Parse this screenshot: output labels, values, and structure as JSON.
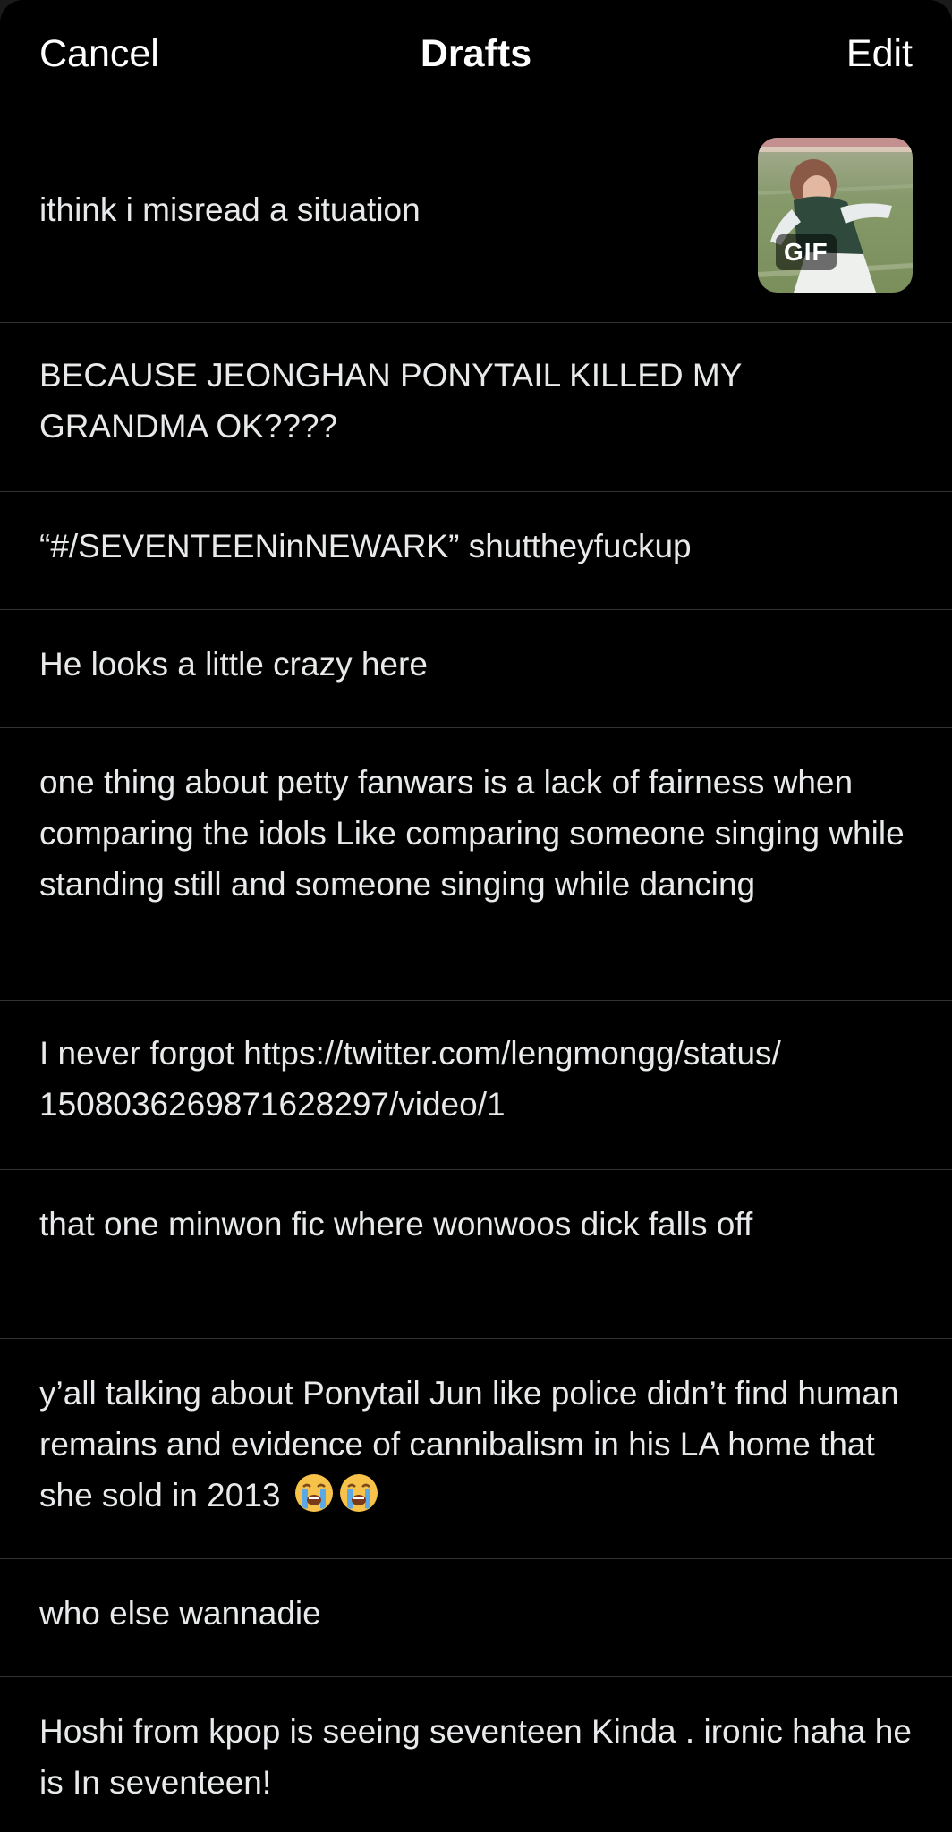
{
  "header": {
    "cancel_label": "Cancel",
    "title": "Drafts",
    "edit_label": "Edit"
  },
  "drafts": [
    {
      "text": "ithink i misread a situation",
      "media_badge": "GIF"
    },
    {
      "text": "BECAUSE JEONGHAN PONYTAIL KILLED MY GRANDMA OK????"
    },
    {
      "text": "“#/SEVENTEENinNEWARK” shuttheyfuckup"
    },
    {
      "text": "He looks a little crazy here"
    },
    {
      "text": "one thing about petty fanwars is a lack of fairness when comparing the idols Like comparing someone singing while standing still and someone singing while dancing"
    },
    {
      "text": "I never forgot https://twitter.com/lengmongg/status/ 1508036269871628297/video/1"
    },
    {
      "text": "that one minwon fic where wonwoos dick falls off"
    },
    {
      "text": "y’all talking about Ponytail Jun like police didn’t find human remains and evidence of cannibalism in his LA home that she sold in 2013",
      "emojis": [
        "loudly-crying-face-icon",
        "loudly-crying-face-icon"
      ]
    },
    {
      "text": "who else wannadie"
    },
    {
      "text": "Hoshi from kpop is seeing seventeen Kinda . ironic haha he is In seventeen!"
    }
  ],
  "colors": {
    "background": "#000000",
    "text": "#e7e9ea",
    "divider": "#2f3336"
  }
}
